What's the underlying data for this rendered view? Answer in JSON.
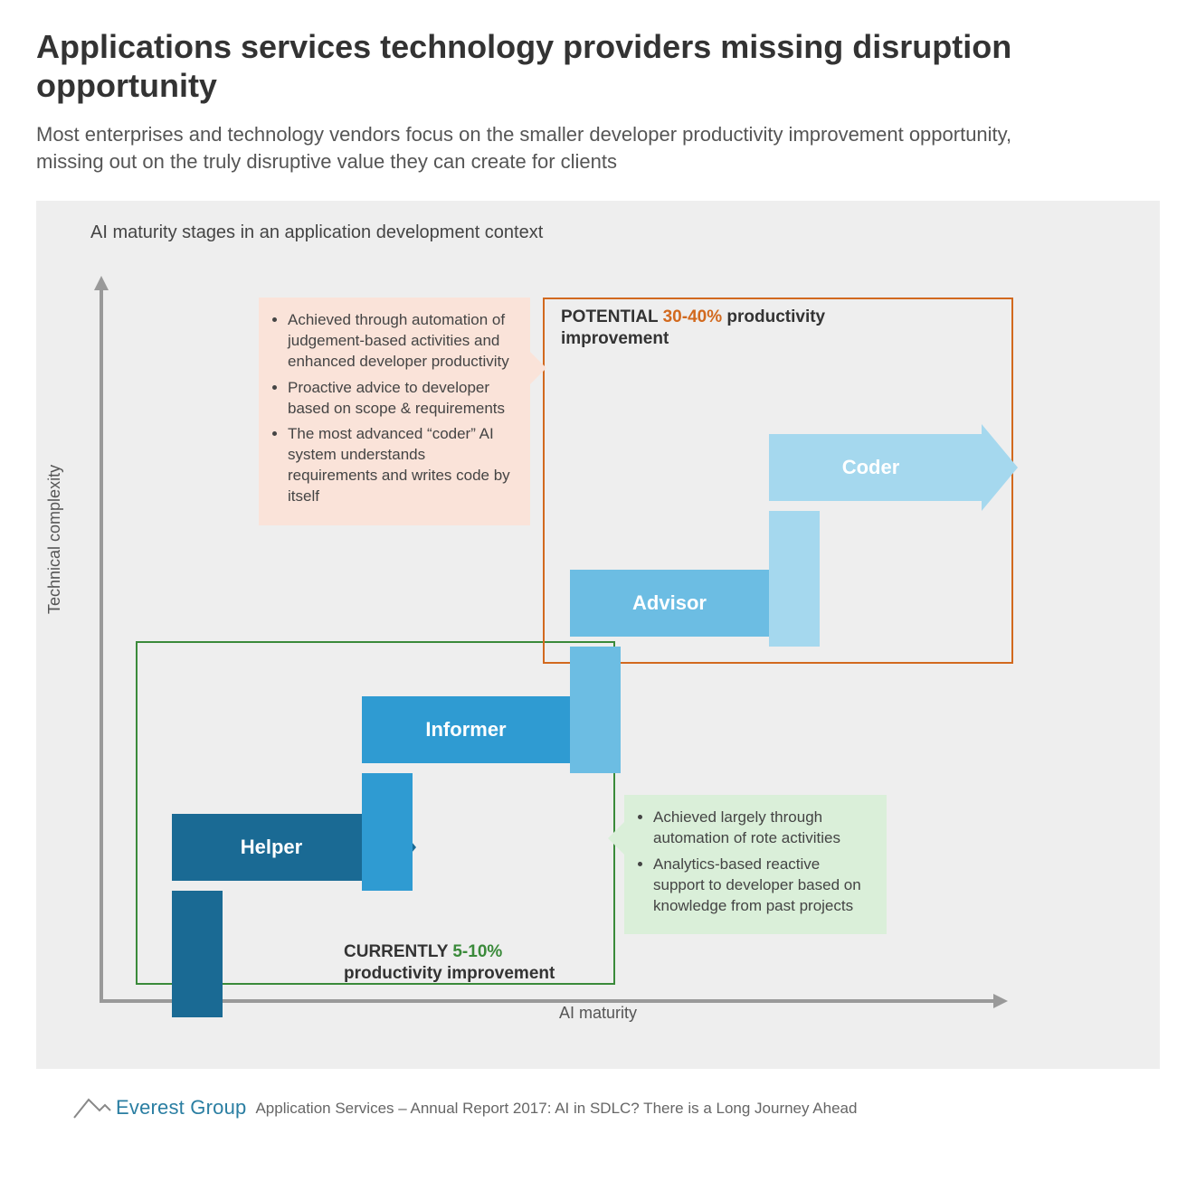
{
  "title": "Applications services technology providers missing disruption opportunity",
  "subtitle": "Most enterprises and technology vendors focus on the smaller developer productivity improvement opportunity, missing out on the truly disruptive value they can create for clients",
  "chart": {
    "heading": "AI maturity stages in an application development context",
    "x_axis": "AI maturity",
    "y_axis": "Technical complexity",
    "steps": [
      "Helper",
      "Informer",
      "Advisor",
      "Coder"
    ],
    "groups": {
      "current": {
        "prefix": "CURRENTLY ",
        "highlight": "5-10%",
        "suffix": " productivity improvement",
        "bullets": [
          "Achieved largely through automation of rote activities",
          "Analytics-based reactive support to developer based on knowledge from past projects"
        ]
      },
      "potential": {
        "prefix": "POTENTIAL ",
        "highlight": "30-40%",
        "suffix": " productivity improvement",
        "bullets": [
          "Achieved through automation of judgement-based activities and enhanced developer productivity",
          "Proactive advice to developer based on scope & requirements",
          "The most advanced “coder” AI system understands requirements and writes code by itself"
        ]
      }
    }
  },
  "footer": {
    "brand": "Everest Group",
    "source": "Application Services – Annual Report 2017: AI in SDLC? There is a Long Journey Ahead"
  },
  "chart_data": {
    "type": "diagram",
    "x_axis": "AI maturity (ordinal, increasing →)",
    "y_axis": "Technical complexity (ordinal, increasing ↑)",
    "stages": [
      {
        "name": "Helper",
        "maturity_rank": 1,
        "complexity_rank": 1,
        "group": "current"
      },
      {
        "name": "Informer",
        "maturity_rank": 2,
        "complexity_rank": 2,
        "group": "current"
      },
      {
        "name": "Advisor",
        "maturity_rank": 3,
        "complexity_rank": 3,
        "group": "potential"
      },
      {
        "name": "Coder",
        "maturity_rank": 4,
        "complexity_rank": 4,
        "group": "potential"
      }
    ],
    "groups": {
      "current": {
        "label": "CURRENTLY 5-10% productivity improvement",
        "productivity_improvement_pct_range": [
          5,
          10
        ]
      },
      "potential": {
        "label": "POTENTIAL 30-40% productivity improvement",
        "productivity_improvement_pct_range": [
          30,
          40
        ]
      }
    }
  }
}
